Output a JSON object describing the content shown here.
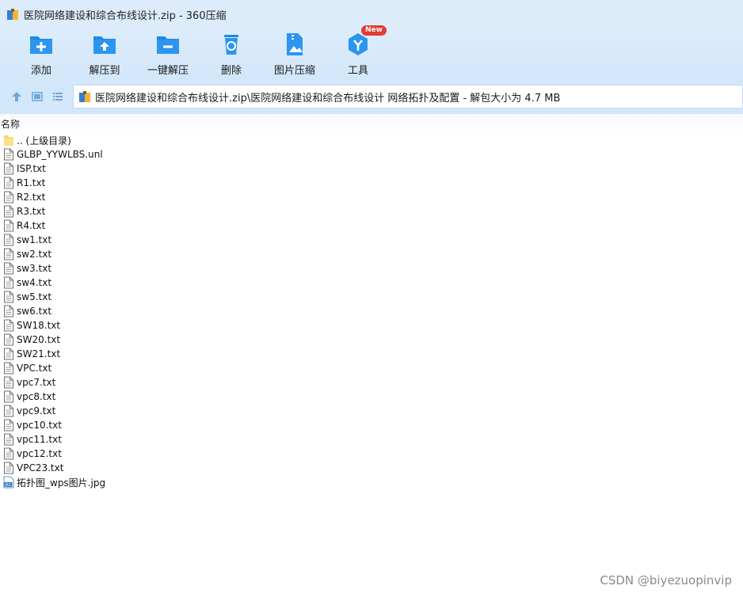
{
  "window": {
    "title": "医院网络建设和综合布线设计.zip - 360压缩"
  },
  "toolbar": {
    "buttons": [
      {
        "label": "添加",
        "icon": "add-folder-icon"
      },
      {
        "label": "解压到",
        "icon": "extract-to-icon"
      },
      {
        "label": "一键解压",
        "icon": "one-click-extract-icon"
      },
      {
        "label": "删除",
        "icon": "delete-icon"
      },
      {
        "label": "图片压缩",
        "icon": "image-compress-icon"
      },
      {
        "label": "工具",
        "icon": "tools-icon",
        "badge": "New"
      }
    ]
  },
  "addressbar": {
    "path": "医院网络建设和综合布线设计.zip\\医院网络建设和综合布线设计 网络拓扑及配置 - 解包大小为 4.7 MB"
  },
  "columns": {
    "name": "名称"
  },
  "files": [
    {
      "name": ".. (上级目录)",
      "type": "folder"
    },
    {
      "name": "GLBP_YYWLBS.unl",
      "type": "file"
    },
    {
      "name": "ISP.txt",
      "type": "file"
    },
    {
      "name": "R1.txt",
      "type": "file"
    },
    {
      "name": "R2.txt",
      "type": "file"
    },
    {
      "name": "R3.txt",
      "type": "file"
    },
    {
      "name": "R4.txt",
      "type": "file"
    },
    {
      "name": "sw1.txt",
      "type": "file"
    },
    {
      "name": "sw2.txt",
      "type": "file"
    },
    {
      "name": "sw3.txt",
      "type": "file"
    },
    {
      "name": "sw4.txt",
      "type": "file"
    },
    {
      "name": "sw5.txt",
      "type": "file"
    },
    {
      "name": "sw6.txt",
      "type": "file"
    },
    {
      "name": "SW18.txt",
      "type": "file"
    },
    {
      "name": "SW20.txt",
      "type": "file"
    },
    {
      "name": "SW21.txt",
      "type": "file"
    },
    {
      "name": "VPC.txt",
      "type": "file"
    },
    {
      "name": "vpc7.txt",
      "type": "file"
    },
    {
      "name": "vpc8.txt",
      "type": "file"
    },
    {
      "name": "vpc9.txt",
      "type": "file"
    },
    {
      "name": "vpc10.txt",
      "type": "file"
    },
    {
      "name": "vpc11.txt",
      "type": "file"
    },
    {
      "name": "vpc12.txt",
      "type": "file"
    },
    {
      "name": "VPC23.txt",
      "type": "file"
    },
    {
      "name": "拓扑图_wps图片.jpg",
      "type": "jpg"
    }
  ],
  "watermark": "CSDN @biyezuopinvip",
  "colors": {
    "accent": "#2a8be0",
    "titlebar": "#dcecfb",
    "badge": "#e53935"
  }
}
